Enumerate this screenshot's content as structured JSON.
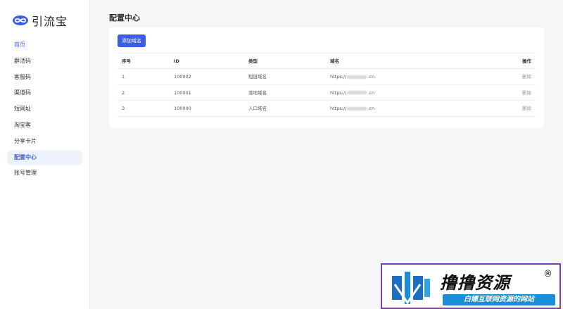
{
  "app": {
    "name": "引流宝"
  },
  "sidebar": {
    "items": [
      {
        "label": "首页"
      },
      {
        "label": "群活码"
      },
      {
        "label": "客服码"
      },
      {
        "label": "渠道码"
      },
      {
        "label": "短网址"
      },
      {
        "label": "淘宝客"
      },
      {
        "label": "分享卡片"
      },
      {
        "label": "配置中心"
      },
      {
        "label": "账号管理"
      }
    ],
    "selected_index": 7
  },
  "page": {
    "title": "配置中心"
  },
  "toolbar": {
    "add_label": "添加域名"
  },
  "table": {
    "headers": {
      "seq": "序号",
      "id": "ID",
      "type": "类型",
      "domain": "域名",
      "op": "操作"
    },
    "rows": [
      {
        "seq": "1",
        "id": "100002",
        "type": "短链域名",
        "domain_prefix": "https://",
        "domain_suffix": ".cn",
        "op": "删除"
      },
      {
        "seq": "2",
        "id": "100001",
        "type": "落地域名",
        "domain_prefix": "https://",
        "domain_suffix": ".cn",
        "op": "删除"
      },
      {
        "seq": "3",
        "id": "100000",
        "type": "入口域名",
        "domain_prefix": "https://",
        "domain_suffix": ".cn",
        "op": "删除"
      }
    ]
  },
  "watermark": {
    "title": "撸撸资源",
    "registered": "®",
    "subtitle": "白嫖互联网资源的网站"
  },
  "colors": {
    "accent": "#3b5de7",
    "selected_bg": "#eef2fd",
    "watermark_border": "#7a3fb0",
    "watermark_blue": "#1a8fd8"
  }
}
